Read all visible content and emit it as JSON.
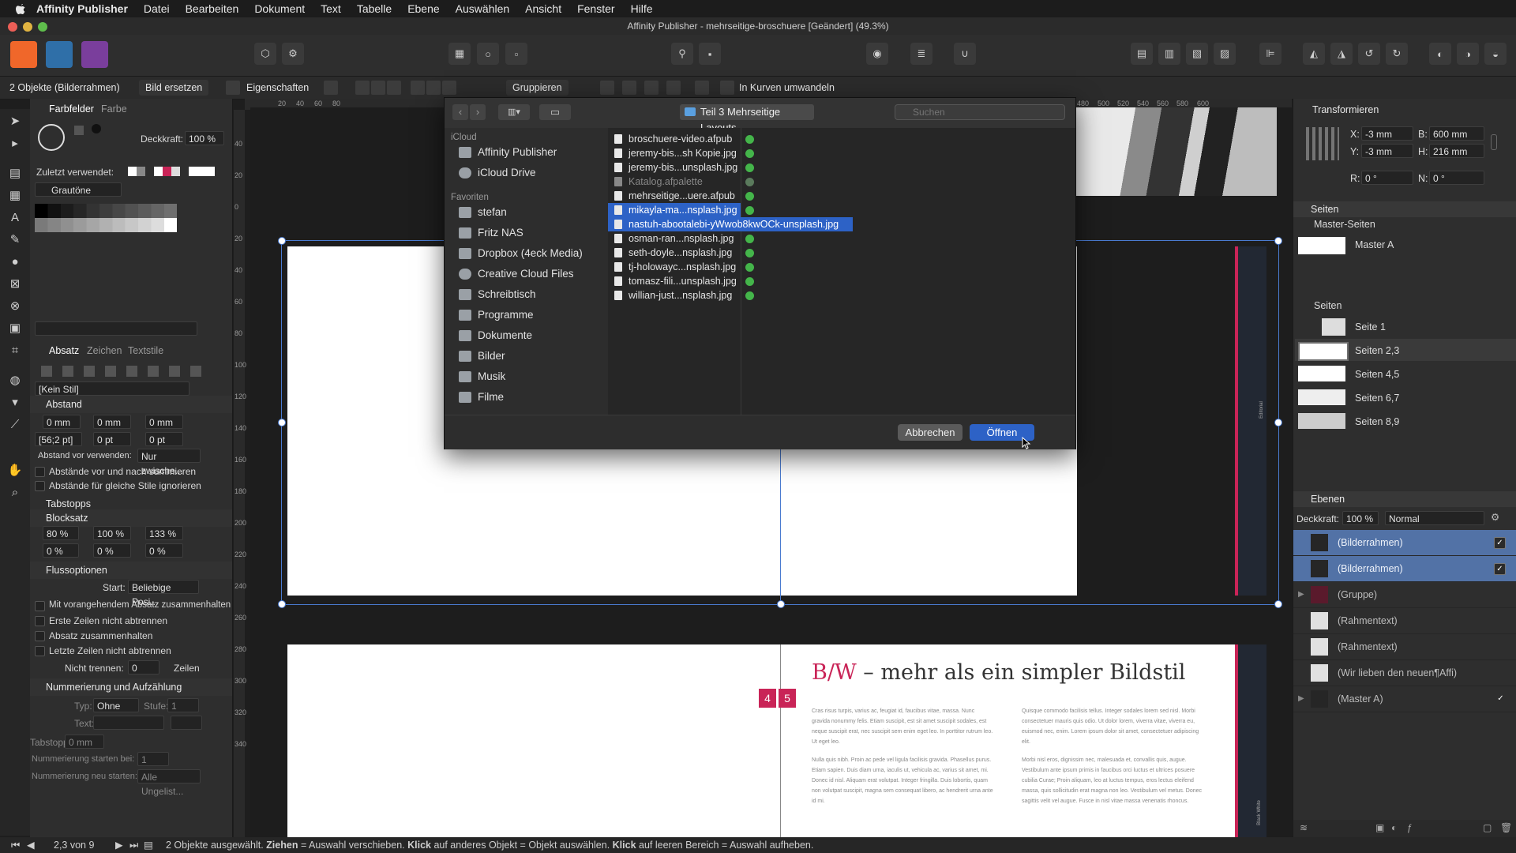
{
  "menubar": {
    "app": "Affinity Publisher",
    "items": [
      "Datei",
      "Bearbeiten",
      "Dokument",
      "Text",
      "Tabelle",
      "Ebene",
      "Auswählen",
      "Ansicht",
      "Fenster",
      "Hilfe"
    ]
  },
  "window": {
    "title": "Affinity Publisher - mehrseitige-broschuere [Geändert] (49.3%)"
  },
  "contextbar": {
    "selection": "2 Objekte (Bilderrahmen)",
    "replace_image": "Bild ersetzen",
    "properties": "Eigenschaften",
    "group": "Gruppieren",
    "to_curves": "In Kurven umwandeln"
  },
  "leftpanel": {
    "tab_swatches": "Farbfelder",
    "tab_color": "Farbe",
    "opacity_label": "Deckkraft:",
    "opacity_value": "100 %",
    "recent_label": "Zuletzt verwendet:",
    "palette": "Grautöne",
    "tab_paragraph": "Absatz",
    "tab_character": "Zeichen",
    "tab_textstyles": "Textstile",
    "style": "[Kein Stil]",
    "spacing_header": "Abstand",
    "indent_left": "0 mm",
    "indent_right": "0 mm",
    "indent_first": "0 mm",
    "leading": "[56;2 pt]",
    "space_before": "0 pt",
    "space_after": "0 pt",
    "space_use_label": "Abstand vor verwenden:",
    "space_use_value": "Nur zwische...",
    "chk_sum": "Abstände vor und nach summieren",
    "chk_ignore": "Abstände für gleiche Stile ignorieren",
    "tabstops": "Tabstopps",
    "justification": "Blocksatz",
    "word_min": "80 %",
    "word_desired": "100 %",
    "word_max": "133 %",
    "letter_min": "0 %",
    "letter_desired": "0 %",
    "letter_max": "0 %",
    "flow_header": "Flussoptionen",
    "start_label": "Start:",
    "start_value": "Beliebige Posi...",
    "chk_keep_prev": "Mit vorangehendem Absatz zusammenhalten",
    "chk_first_lines": "Erste Zeilen nicht abtrennen",
    "chk_keep_together": "Absatz zusammenhalten",
    "chk_last_lines": "Letzte Zeilen nicht abtrennen",
    "no_break_label": "Nicht trennen:",
    "no_break_value": "0",
    "no_break_unit": "Zeilen",
    "numbering_header": "Nummerierung und Aufzählung",
    "type_label": "Typ:",
    "type_value": "Ohne Li...",
    "level_label": "Stufe:",
    "level_value": "1",
    "text_label": "Text:",
    "tabstop_label": "Tabstopp:",
    "tabstop_value": "0 mm",
    "num_start_label": "Nummerierung starten bei:",
    "num_start_value": "1",
    "num_restart_label": "Nummerierung neu starten:",
    "num_restart_value": "Alle Ungelist..."
  },
  "ruler_top": [
    "20",
    "40",
    "60",
    "80",
    "480",
    "500",
    "520",
    "540",
    "560",
    "580",
    "600"
  ],
  "ruler_left": [
    "40",
    "20",
    "0",
    "20",
    "40",
    "60",
    "80",
    "100",
    "120",
    "140",
    "160",
    "180",
    "200",
    "220",
    "240",
    "260",
    "280",
    "300",
    "320",
    "340"
  ],
  "dialog": {
    "location": "Teil 3 Mehrseitige Layouts",
    "search_placeholder": "Suchen",
    "icloud_header": "iCloud",
    "icloud_items": [
      "Affinity Publisher",
      "iCloud Drive"
    ],
    "favorites_header": "Favoriten",
    "favorites": [
      "stefan",
      "Fritz NAS",
      "Dropbox (4eck Media)",
      "Creative Cloud Files",
      "Schreibtisch",
      "Programme",
      "Dokumente",
      "Bilder",
      "Musik",
      "Filme"
    ],
    "files": [
      "broschuere-video.afpub",
      "jeremy-bis...sh Kopie.jpg",
      "jeremy-bis...unsplash.jpg",
      "Katalog.afpalette",
      "mehrseitige...uere.afpub",
      "mikayla-ma...nsplash.jpg",
      "nastuh-abootalebi-yWwob8kwOCk-unsplash.jpg",
      "osman-ran...nsplash.jpg",
      "seth-doyle...nsplash.jpg",
      "tj-holowayc...nsplash.jpg",
      "tomasz-fili...unsplash.jpg",
      "willian-just...nsplash.jpg"
    ],
    "cancel": "Abbrechen",
    "open": "Öffnen"
  },
  "document": {
    "heading_accent": "B/W",
    "heading_rest": " – mehr als ein simpler Bildstil",
    "page_left_num": "4",
    "page_right_num": "5",
    "col1_p1": "Cras risus turpis, varius ac, feugiat id, faucibus vitae, massa. Nunc gravida nonummy felis. Etiam suscipit, est sit amet suscipit sodales, est neque suscipit erat, nec suscipit sem enim eget leo. In porttitor rutrum leo. Ut eget leo.",
    "col1_p2": "Nulla quis nibh. Proin ac pede vel ligula facilisis gravida. Phasellus purus. Etiam sapien. Duis diam urna, iaculis ut, vehicula ac, varius sit amet, mi. Donec id nisl. Aliquam erat volutpat. Integer fringilla. Duis lobortis, quam non volutpat suscipit, magna sem consequat libero, ac hendrerit urna ante id mi.",
    "col2_p1": "Quisque commodo facilisis tellus. Integer sodales lorem sed nisl. Morbi consectetuer mauris quis odio. Ut dolor lorem, viverra vitae, viverra eu, euismod nec, enim. Lorem ipsum dolor sit amet, consectetuer adipiscing elit.",
    "col2_p2": "Morbi nisl eros, dignissim nec, malesuada et, convallis quis, augue. Vestibulum ante ipsum primis in faucibus orci luctus et ultrices posuere cubilia Curae; Proin aliquam, leo at luctus tempus, eros lectus eleifend massa, quis sollicitudin erat magna non leo. Vestibulum vel metus. Donec sagittis velit vel augue. Fusce in nisl vitae massa venenatis rhoncus.",
    "side_label_top": "Editorial",
    "side_label_bottom": "Black White"
  },
  "rightpanel": {
    "transform_header": "Transformieren",
    "x_label": "X:",
    "x_value": "-3 mm",
    "y_label": "Y:",
    "y_value": "-3 mm",
    "b_label": "B:",
    "b_value": "600 mm",
    "h_label": "H:",
    "h_value": "216 mm",
    "r_label": "R:",
    "r_value": "0 °",
    "n_label": "N:",
    "n_value": "0 °",
    "pages_tab": "Seiten",
    "master_header": "Master-Seiten",
    "master_a": "Master A",
    "pages_header": "Seiten",
    "pages": [
      "Seite 1",
      "Seiten 2,3",
      "Seiten 4,5",
      "Seiten 6,7",
      "Seiten 8,9"
    ],
    "layers_tab": "Ebenen",
    "layer_opacity_label": "Deckkraft:",
    "layer_opacity_value": "100 %",
    "blend_mode": "Normal",
    "layers": [
      "(Bilderrahmen)",
      "(Bilderrahmen)",
      "(Gruppe)",
      "(Rahmentext)",
      "(Rahmentext)",
      "(Wir lieben den neuen¶Affi)",
      "(Master A)"
    ]
  },
  "statusbar": {
    "page": "2,3 von 9",
    "m1": "2 Objekte ausgewählt. ",
    "k1": "Ziehen",
    "m2": " = Auswahl verschieben. ",
    "k2": "Klick",
    "m3": " auf anderes Objekt = Objekt auswählen. ",
    "k3": "Klick",
    "m4": " auf leeren Bereich = Auswahl aufheben."
  },
  "colors": {
    "accent_red": "#c92457",
    "selection_blue": "#2d62c6",
    "layer_selected": "#5272a6"
  }
}
